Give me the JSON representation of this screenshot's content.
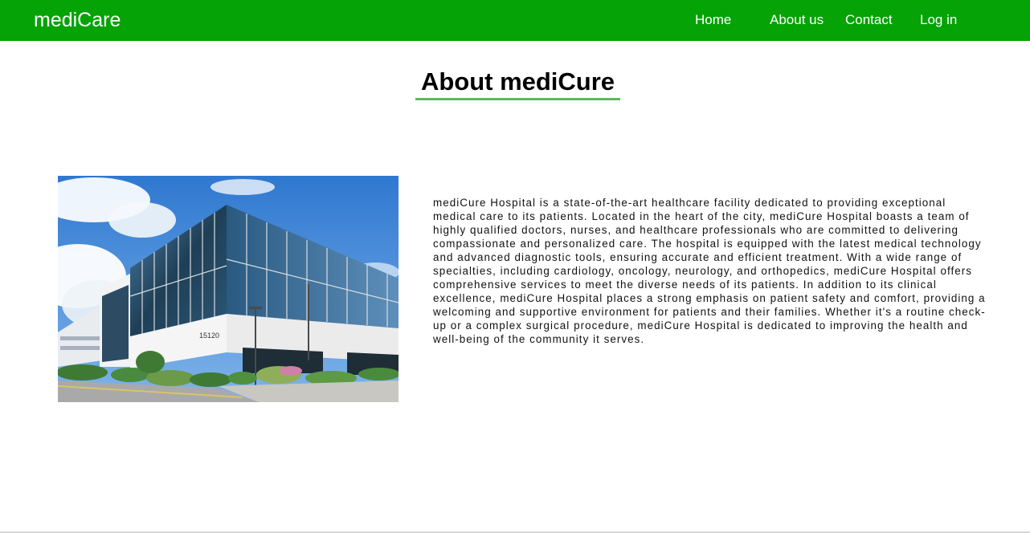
{
  "navbar": {
    "brand": "mediCare",
    "links": [
      "Home",
      "About us",
      "Contact",
      "Log in"
    ],
    "background_color": "#05a305"
  },
  "main": {
    "title": "About mediCure",
    "underline_color": "#5cb85c",
    "image": {
      "icon": "hospital-building-photo",
      "building_number": "15120"
    },
    "description": "mediCure Hospital is a state-of-the-art healthcare facility dedicated to providing exceptional medical care to its patients. Located in the heart of the city, mediCure Hospital boasts a team of highly qualified doctors, nurses, and healthcare professionals who are committed to delivering compassionate and personalized care. The hospital is equipped with the latest medical technology and advanced diagnostic tools, ensuring accurate and efficient treatment. With a wide range of specialties, including cardiology, oncology, neurology, and orthopedics, mediCure Hospital offers comprehensive services to meet the diverse needs of its patients. In addition to its clinical excellence, mediCure Hospital places a strong emphasis on patient safety and comfort, providing a welcoming and supportive environment for patients and their families. Whether it's a routine check-up or a complex surgical procedure, mediCure Hospital is dedicated to improving the health and well-being of the community it serves."
  }
}
